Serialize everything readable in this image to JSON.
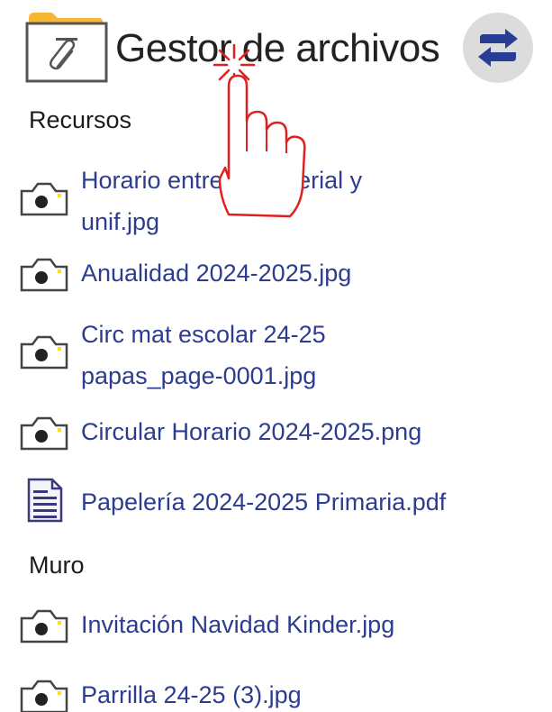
{
  "header": {
    "title": "Gestor de archivos",
    "folder_icon": "folder-paperclip-icon",
    "sync_icon": "sync-arrows-icon",
    "accent": "#283e96"
  },
  "sections": [
    {
      "heading": "Recursos",
      "files": [
        {
          "icon": "camera-icon",
          "label_line1": "Horario entrega material y",
          "label_line2": "unif.jpg"
        },
        {
          "icon": "camera-icon",
          "label_line1": "Anualidad 2024-2025.jpg"
        },
        {
          "icon": "camera-icon",
          "label_line1": "Circ mat escolar 24-25",
          "label_line2": "papas_page-0001.jpg"
        },
        {
          "icon": "camera-icon",
          "label_line1": "Circular Horario 2024-2025.png"
        },
        {
          "icon": "document-icon",
          "label_line1": "Papelería 2024-2025 Primaria.pdf"
        }
      ]
    },
    {
      "heading": "Muro",
      "files": [
        {
          "icon": "camera-icon",
          "label_line1": "Invitación Navidad Kinder.jpg"
        },
        {
          "icon": "camera-icon",
          "label_line1": "Parrilla 24-25 (3).jpg"
        }
      ]
    }
  ],
  "colors": {
    "link": "#2c3d8f",
    "folder": "#f7b733",
    "sync_bg": "#dcdcdc"
  }
}
